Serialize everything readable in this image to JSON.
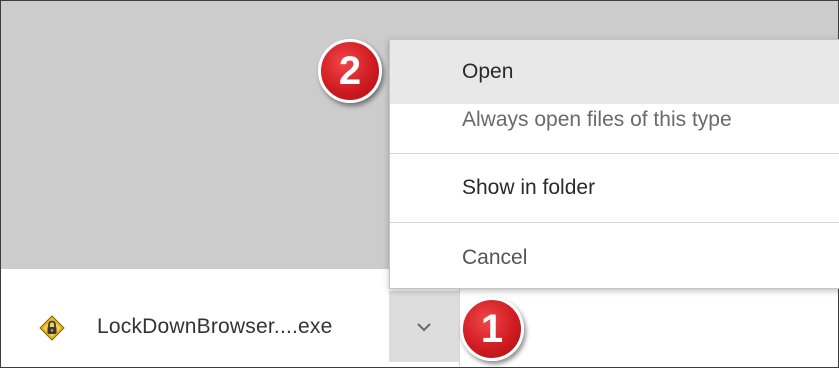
{
  "download": {
    "file_name": "LockDownBrowser....exe",
    "icon": "lockdown-browser-lock-icon",
    "dropdown_icon": "chevron-down-icon"
  },
  "menu": {
    "items": [
      {
        "label": "Open"
      },
      {
        "label": "Always open files of this type"
      },
      {
        "label": "Show in folder"
      },
      {
        "label": "Cancel"
      }
    ]
  },
  "annotations": {
    "step_1": "1",
    "step_2": "2"
  },
  "colors": {
    "badge": "#d01c21",
    "page_background": "#cccccc",
    "menu_hover": "#e8e8e8"
  }
}
